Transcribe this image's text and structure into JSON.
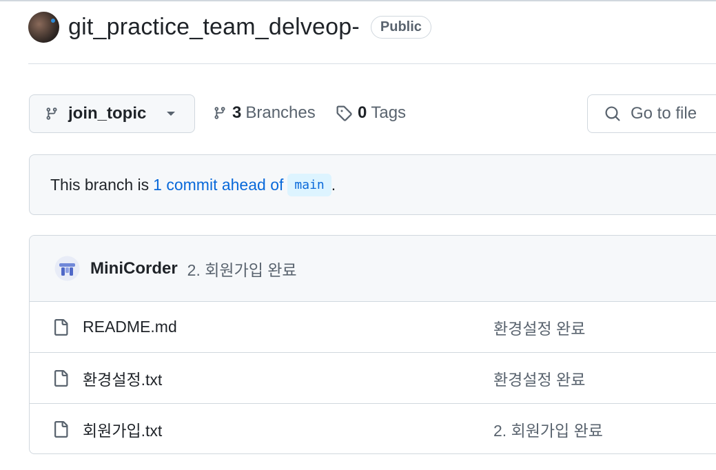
{
  "repo": {
    "name": "git_practice_team_delveop-",
    "visibility": "Public"
  },
  "toolbar": {
    "branch": "join_topic",
    "branches_count": "3",
    "branches_label": "Branches",
    "tags_count": "0",
    "tags_label": "Tags",
    "goto_placeholder": "Go to file"
  },
  "notice": {
    "prefix": "This branch is",
    "link": "1 commit ahead of",
    "base_branch": "main",
    "suffix": "."
  },
  "latest_commit": {
    "author": "MiniCorder",
    "message": "2. 회원가입 완료"
  },
  "files": [
    {
      "name": "README.md",
      "commit": "환경설정 완료"
    },
    {
      "name": "환경설정.txt",
      "commit": "환경설정 완료"
    },
    {
      "name": "회원가입.txt",
      "commit": "2. 회원가입 완료"
    }
  ],
  "icons": {
    "branch": "git-branch-icon",
    "tag": "tag-icon",
    "search": "search-icon",
    "file": "file-icon"
  },
  "colors": {
    "link": "#0969da",
    "code_bg": "#ddf4ff",
    "panel_bg": "#f6f8fa",
    "border": "#d0d7de"
  }
}
